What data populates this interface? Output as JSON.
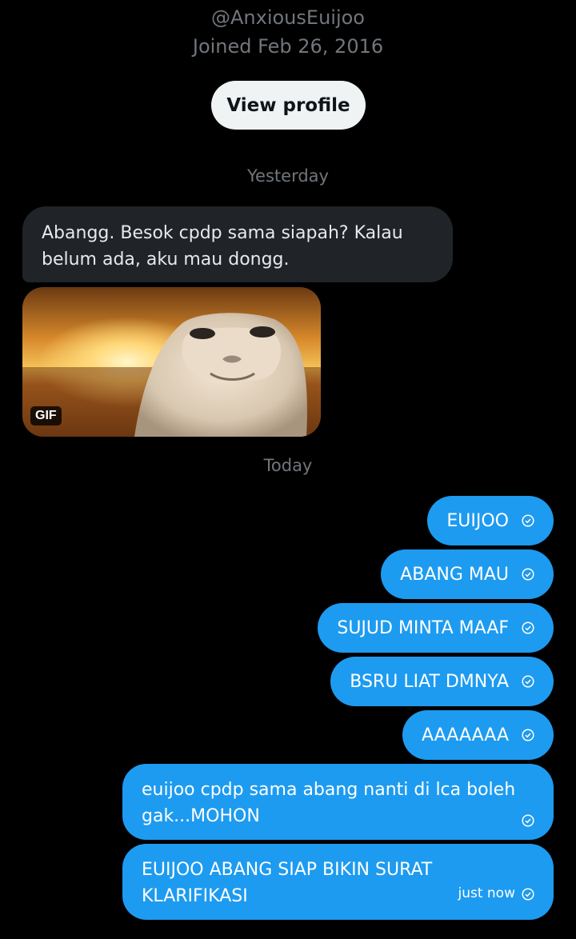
{
  "profile": {
    "handle": "@AnxiousEuijoo",
    "joined": "Joined Feb 26, 2016",
    "view_profile_label": "View profile"
  },
  "separators": {
    "yesterday": "Yesterday",
    "today": "Today"
  },
  "incoming": {
    "text": "Abangg. Besok cpdp sama siapah? Kalau belum ada, aku mau dongg.",
    "gif_badge": "GIF"
  },
  "outgoing": [
    {
      "text": "EUIJOO"
    },
    {
      "text": "ABANG MAU"
    },
    {
      "text": "SUJUD MINTA MAAF"
    },
    {
      "text": "BSRU LIAT DMNYA"
    },
    {
      "text": "AAAAAAA"
    },
    {
      "text": "euijoo cpdp sama abang nanti di lca boleh gak...MOHON"
    },
    {
      "text": "EUIJOO ABANG SIAP BIKIN SURAT KLARIFIKASI",
      "time": "just now"
    }
  ],
  "icons": {
    "sent_status": "check-circle-icon"
  },
  "colors": {
    "background": "#000000",
    "outgoing_bubble": "#1d9bf0",
    "incoming_bubble": "#202327",
    "muted_text": "#71767b"
  }
}
